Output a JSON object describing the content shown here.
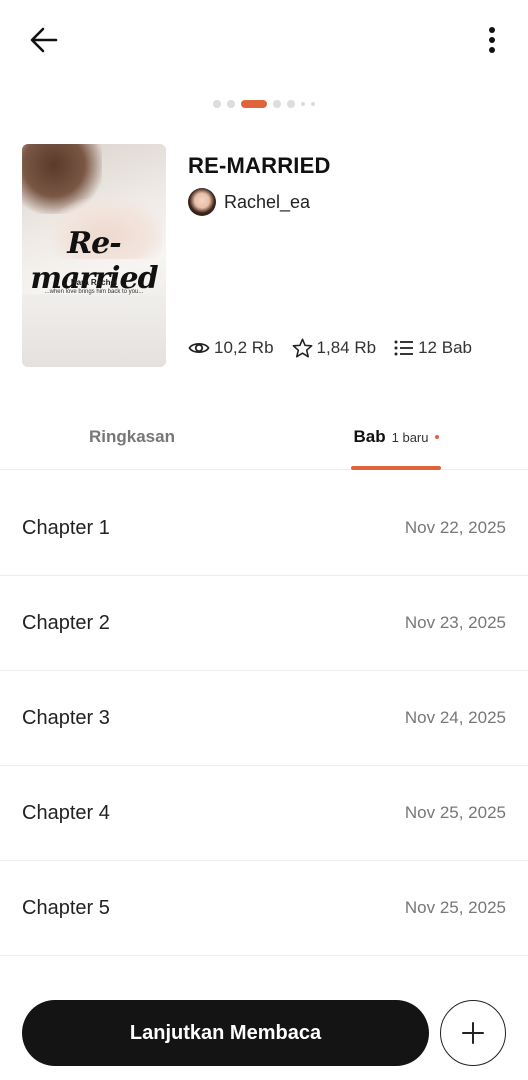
{
  "header": {
    "back_icon": "arrow-left-icon",
    "more_icon": "more-vertical-icon"
  },
  "carousel": {
    "count": 7,
    "active_index": 2
  },
  "book": {
    "title": "RE-MARRIED",
    "author": "Rachel_ea",
    "cover": {
      "title": "Re-married",
      "author": "Rara Rachel",
      "tagline": "...when love brings him back to you..."
    },
    "stats": {
      "views": "10,2 Rb",
      "stars": "1,84 Rb",
      "chapters": "12 Bab"
    }
  },
  "tabs": {
    "summary_label": "Ringkasan",
    "chapters_label": "Bab",
    "chapters_badge": "1 baru"
  },
  "chapters": [
    {
      "title": "Chapter 1",
      "date": "Nov 22, 2025"
    },
    {
      "title": "Chapter 2",
      "date": "Nov 23, 2025"
    },
    {
      "title": "Chapter 3",
      "date": "Nov 24, 2025"
    },
    {
      "title": "Chapter 4",
      "date": "Nov 25, 2025"
    },
    {
      "title": "Chapter 5",
      "date": "Nov 25, 2025"
    }
  ],
  "actions": {
    "continue_label": "Lanjutkan Membaca",
    "add_icon": "plus-icon"
  },
  "colors": {
    "accent": "#e0643a",
    "button_dark": "#141414"
  }
}
